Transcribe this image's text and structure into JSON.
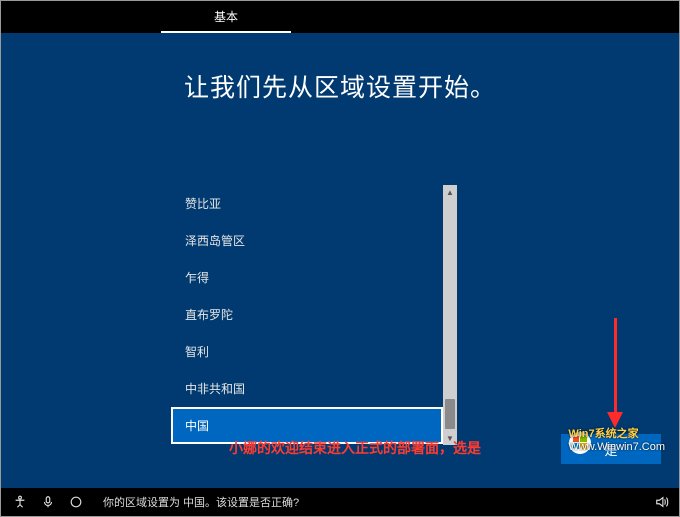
{
  "tabs": {
    "active": "基本"
  },
  "page": {
    "title": "让我们先从区域设置开始。"
  },
  "regions": {
    "items": [
      {
        "label": "赞比亚",
        "selected": false
      },
      {
        "label": "泽西岛管区",
        "selected": false
      },
      {
        "label": "乍得",
        "selected": false
      },
      {
        "label": "直布罗陀",
        "selected": false
      },
      {
        "label": "智利",
        "selected": false
      },
      {
        "label": "中非共和国",
        "selected": false
      },
      {
        "label": "中国",
        "selected": true
      }
    ]
  },
  "caption": "小娜的欢迎结束进入正式的部署面，选是",
  "buttons": {
    "yes": "是"
  },
  "statusbar": {
    "question": "你的区域设置为 中国。该设置是否正确?"
  },
  "watermark": {
    "line1": "Win7系统之家",
    "line2": "Www.Winwin7.Com"
  },
  "icons": {
    "accessibility": "accessibility-icon",
    "microphone": "microphone-icon",
    "cortana": "cortana-icon",
    "volume": "volume-icon"
  }
}
